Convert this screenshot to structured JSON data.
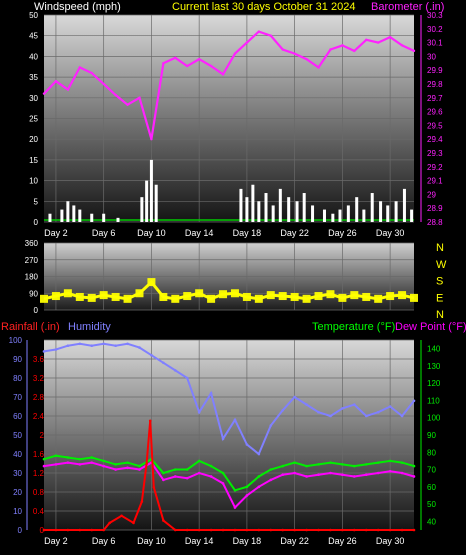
{
  "header": {
    "wind_title": "Windspeed (mph)",
    "period_title": "Current last 30 days October 31 2024",
    "baro_title": "Barometer (.in)"
  },
  "colors": {
    "wind": "#ffffff",
    "gust_line": "#00cc00",
    "barometer": "#ff22ff",
    "direction": "#ffff00",
    "rain": "#ff0000",
    "humidity": "#8080ff",
    "temperature": "#00ee00",
    "dewpoint": "#ff00ff",
    "wind_title": "#ffffff",
    "period_title": "#ffff00",
    "rain_title": "#ff2222",
    "humidity_title": "#8080ff",
    "temp_title": "#00ff00",
    "dew_title": "#ff00ff"
  },
  "x_ticks": [
    "Day 2",
    "Day 6",
    "Day 10",
    "Day 14",
    "Day 18",
    "Day 22",
    "Day 26",
    "Day 30"
  ],
  "wind_chart": {
    "left_ticks": [
      "50",
      "45",
      "40",
      "35",
      "30",
      "25",
      "20",
      "15",
      "10",
      "5",
      "0"
    ],
    "right_ticks": [
      "30.3",
      "30.2",
      "30.1",
      "30",
      "29.9",
      "29.8",
      "29.7",
      "29.6",
      "29.5",
      "29.4",
      "29.3",
      "29.2",
      "29.1",
      "29",
      "28.9",
      "28.8"
    ]
  },
  "direction_chart": {
    "left_ticks": [
      "360",
      "270",
      "180",
      "90",
      "0"
    ],
    "compass": [
      "N",
      "W",
      "S",
      "E",
      "N"
    ]
  },
  "lower_chart": {
    "rain_title": "Rainfall (.in)",
    "humidity_title": "Humidity",
    "temp_title": "Temperature (°F)",
    "dew_title": "Dew Point (°F)",
    "humidity_ticks": [
      "100",
      "90",
      "80",
      "70",
      "60",
      "50",
      "40",
      "30",
      "20",
      "10",
      "0"
    ],
    "rain_ticks": [
      "3.6",
      "3.2",
      "2.8",
      "2.4",
      "2",
      "1.6",
      "1.2",
      "0.8",
      "0.4",
      "0"
    ],
    "temp_ticks": [
      "140",
      "130",
      "120",
      "110",
      "100",
      "90",
      "80",
      "70",
      "60",
      "50",
      "40"
    ]
  },
  "chart_data": [
    {
      "type": "line",
      "title": "Windspeed (mph) / Barometer (.in)",
      "x_label": "day",
      "x_range": [
        1,
        32
      ],
      "y_left_range": [
        0,
        50
      ],
      "y_right_range": [
        28.8,
        30.3
      ],
      "series": [
        {
          "name": "Barometer (.in)",
          "axis": "right",
          "x": [
            1,
            2,
            3,
            4,
            5,
            6,
            7,
            8,
            9,
            10,
            11,
            12,
            13,
            14,
            15,
            16,
            17,
            18,
            19,
            20,
            21,
            22,
            23,
            24,
            25,
            26,
            27,
            28,
            29,
            30,
            31,
            32
          ],
          "values": [
            29.73,
            29.82,
            29.76,
            29.92,
            29.88,
            29.8,
            29.72,
            29.65,
            29.7,
            29.4,
            29.95,
            29.99,
            29.93,
            29.98,
            29.93,
            29.87,
            30.02,
            30.1,
            30.18,
            30.15,
            30.05,
            30.02,
            29.98,
            29.92,
            30.05,
            30.08,
            30.04,
            30.12,
            30.1,
            30.14,
            30.08,
            30.04
          ]
        },
        {
          "name": "Windspeed (mph)",
          "axis": "left",
          "type": "bar",
          "x": [
            1.5,
            2.5,
            3.0,
            3.5,
            4.0,
            5.0,
            6.0,
            7.2,
            9.2,
            9.6,
            10.0,
            10.4,
            17.5,
            18.0,
            18.5,
            19.0,
            19.6,
            20.2,
            20.8,
            21.5,
            22.2,
            22.8,
            23.5,
            24.5,
            25.2,
            25.8,
            26.5,
            27.2,
            27.8,
            28.5,
            29.2,
            29.8,
            30.5,
            31.2,
            31.8
          ],
          "values": [
            2,
            3,
            5,
            4,
            3,
            2,
            2,
            1,
            6,
            10,
            15,
            9,
            8,
            6,
            9,
            5,
            7,
            4,
            8,
            6,
            5,
            7,
            4,
            3,
            2,
            3,
            4,
            6,
            3,
            7,
            5,
            4,
            5,
            8,
            3
          ]
        }
      ]
    },
    {
      "type": "line",
      "title": "Wind direction",
      "y_range": [
        0,
        360
      ],
      "series": [
        {
          "name": "Wind direction",
          "x": [
            1,
            2,
            3,
            4,
            5,
            6,
            7,
            8,
            9,
            10,
            11,
            12,
            13,
            14,
            15,
            16,
            17,
            18,
            19,
            20,
            21,
            22,
            23,
            24,
            25,
            26,
            27,
            28,
            29,
            30,
            31,
            32
          ],
          "values": [
            60,
            75,
            90,
            70,
            65,
            80,
            70,
            60,
            90,
            150,
            70,
            60,
            75,
            90,
            60,
            85,
            90,
            70,
            60,
            80,
            75,
            70,
            60,
            75,
            85,
            65,
            80,
            70,
            60,
            75,
            80,
            65
          ]
        }
      ]
    },
    {
      "type": "line",
      "title": "Rainfall / Humidity / Temperature / Dew Point",
      "x_range": [
        1,
        32
      ],
      "y_humidity_range": [
        0,
        100
      ],
      "y_rain_range": [
        0,
        4
      ],
      "y_temp_range": [
        35,
        145
      ],
      "series": [
        {
          "name": "Humidity",
          "axis": "humidity",
          "x": [
            1,
            2,
            3,
            4,
            5,
            6,
            7,
            8,
            9,
            10,
            11,
            12,
            13,
            14,
            15,
            16,
            17,
            18,
            19,
            20,
            21,
            22,
            23,
            24,
            25,
            26,
            27,
            28,
            29,
            30,
            31,
            32
          ],
          "values": [
            94,
            95,
            97,
            98,
            97,
            98,
            97,
            98,
            96,
            92,
            88,
            84,
            80,
            62,
            72,
            48,
            58,
            45,
            40,
            55,
            63,
            70,
            66,
            62,
            60,
            64,
            66,
            60,
            62,
            65,
            60,
            68
          ]
        },
        {
          "name": "Temperature (°F)",
          "axis": "temp",
          "x": [
            1,
            2,
            3,
            4,
            5,
            6,
            7,
            8,
            9,
            10,
            11,
            12,
            13,
            14,
            15,
            16,
            17,
            18,
            19,
            20,
            21,
            22,
            23,
            24,
            25,
            26,
            27,
            28,
            29,
            30,
            31,
            32
          ],
          "values": [
            76,
            78,
            77,
            76,
            77,
            75,
            73,
            74,
            72,
            76,
            68,
            70,
            70,
            75,
            72,
            68,
            58,
            60,
            66,
            70,
            72,
            74,
            72,
            73,
            74,
            73,
            72,
            73,
            74,
            75,
            74,
            72
          ]
        },
        {
          "name": "Dew Point (°F)",
          "axis": "temp",
          "x": [
            1,
            2,
            3,
            4,
            5,
            6,
            7,
            8,
            9,
            10,
            11,
            12,
            13,
            14,
            15,
            16,
            17,
            18,
            19,
            20,
            21,
            22,
            23,
            24,
            25,
            26,
            27,
            28,
            29,
            30,
            31,
            32
          ],
          "values": [
            72,
            73,
            74,
            73,
            74,
            72,
            70,
            71,
            70,
            74,
            64,
            66,
            65,
            68,
            66,
            62,
            48,
            55,
            60,
            64,
            67,
            68,
            66,
            67,
            68,
            67,
            66,
            67,
            68,
            69,
            68,
            66
          ]
        },
        {
          "name": "Rainfall (.in)",
          "axis": "rain",
          "x": [
            1,
            2,
            3,
            4,
            5,
            6,
            6.5,
            7.5,
            8.5,
            9.2,
            9.6,
            9.9,
            10.2,
            11,
            12,
            13,
            14,
            15,
            16,
            17,
            18,
            19,
            20,
            21,
            22,
            23,
            24,
            25,
            26,
            27,
            28,
            29,
            30,
            31,
            32
          ],
          "values": [
            0,
            0,
            0,
            0,
            0,
            0,
            0.15,
            0.3,
            0.15,
            0.6,
            1.4,
            2.3,
            0.9,
            0.2,
            0,
            0,
            0,
            0,
            0,
            0,
            0,
            0,
            0,
            0,
            0,
            0,
            0,
            0,
            0,
            0,
            0,
            0,
            0,
            0,
            0
          ]
        }
      ]
    }
  ]
}
